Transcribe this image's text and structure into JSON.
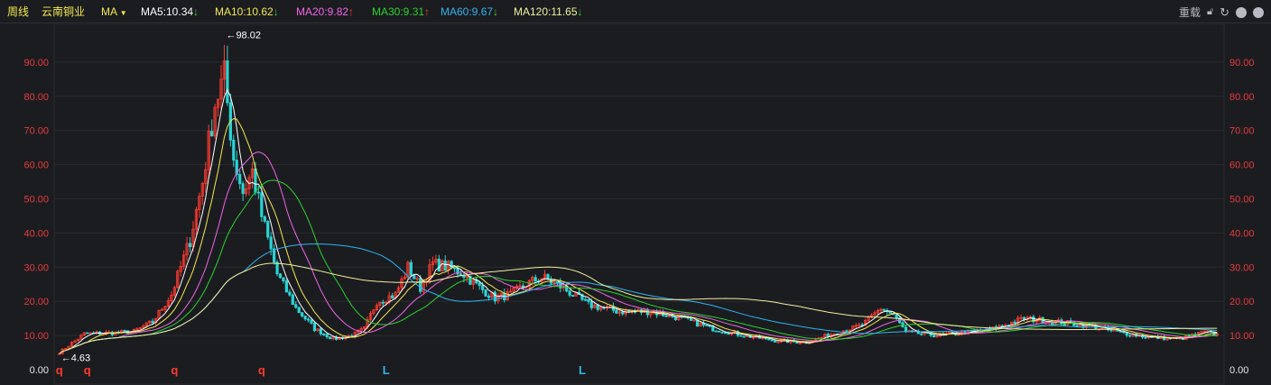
{
  "toolbar": {
    "period": "周线",
    "stock_name": "云南铜业",
    "indicator": "MA",
    "ma": [
      {
        "label": "MA5:10.34",
        "arrow": "↓",
        "color": "#ffffff",
        "arrow_color": "#2bd32b"
      },
      {
        "label": "MA10:10.62",
        "arrow": "↓",
        "color": "#f6e94c",
        "arrow_color": "#2bd32b"
      },
      {
        "label": "MA20:9.82",
        "arrow": "↑",
        "color": "#f065e8",
        "arrow_color": "#ff3b30"
      },
      {
        "label": "MA30:9.31",
        "arrow": "↑",
        "color": "#2bd32b",
        "arrow_color": "#ff3b30"
      },
      {
        "label": "MA60:9.67",
        "arrow": "↓",
        "color": "#2fb5f0",
        "arrow_color": "#2bd32b"
      },
      {
        "label": "MA120:11.65",
        "arrow": "↓",
        "color": "#f2ef9b",
        "arrow_color": "#2bd32b"
      }
    ],
    "reload_label": "重载",
    "icons": [
      "lock-icon",
      "refresh-icon",
      "zoom-in-icon",
      "zoom-out-icon"
    ]
  },
  "chart_data": {
    "type": "candlestick",
    "ylim": [
      0,
      100
    ],
    "y_ticks": [
      "0.00",
      "10.00",
      "20.00",
      "30.00",
      "40.00",
      "50.00",
      "60.00",
      "70.00",
      "80.00",
      "90.00"
    ],
    "y_tick_values": [
      0,
      10,
      20,
      30,
      40,
      50,
      60,
      70,
      80,
      90
    ],
    "max_annotation": "←98.02",
    "min_annotation": "←4.63",
    "max_value": 98.02,
    "min_value": 4.63,
    "price_path": [
      [
        0,
        5.0
      ],
      [
        8,
        10.5
      ],
      [
        18,
        10.8
      ],
      [
        24,
        11.2
      ],
      [
        30,
        14
      ],
      [
        36,
        22
      ],
      [
        42,
        38
      ],
      [
        46,
        55
      ],
      [
        50,
        78
      ],
      [
        53,
        86
      ],
      [
        56,
        62
      ],
      [
        59,
        52
      ],
      [
        62,
        58
      ],
      [
        65,
        45
      ],
      [
        70,
        28
      ],
      [
        76,
        18
      ],
      [
        82,
        12
      ],
      [
        88,
        9
      ],
      [
        94,
        10
      ],
      [
        98,
        12
      ],
      [
        102,
        20
      ],
      [
        108,
        22
      ],
      [
        112,
        30
      ],
      [
        116,
        24
      ],
      [
        120,
        31
      ],
      [
        125,
        30
      ],
      [
        130,
        28
      ],
      [
        135,
        24
      ],
      [
        140,
        21
      ],
      [
        145,
        22
      ],
      [
        150,
        25
      ],
      [
        155,
        27
      ],
      [
        160,
        25
      ],
      [
        165,
        22
      ],
      [
        170,
        19
      ],
      [
        175,
        18
      ],
      [
        180,
        17
      ],
      [
        190,
        17
      ],
      [
        200,
        15
      ],
      [
        210,
        12
      ],
      [
        220,
        10
      ],
      [
        230,
        8.5
      ],
      [
        240,
        8
      ],
      [
        250,
        11
      ],
      [
        258,
        13
      ],
      [
        264,
        18
      ],
      [
        268,
        16
      ],
      [
        272,
        11
      ],
      [
        282,
        10
      ],
      [
        292,
        11
      ],
      [
        300,
        12
      ],
      [
        310,
        15
      ],
      [
        320,
        14
      ],
      [
        330,
        13
      ],
      [
        340,
        11
      ],
      [
        350,
        9.5
      ],
      [
        360,
        9
      ],
      [
        368,
        11
      ],
      [
        372,
        10.3
      ]
    ],
    "markers": [
      {
        "label": "q",
        "index": 0,
        "color": "#ff3b30"
      },
      {
        "label": "q",
        "index": 9,
        "color": "#ff3b30"
      },
      {
        "label": "q",
        "index": 37,
        "color": "#ff3b30"
      },
      {
        "label": "q",
        "index": 65,
        "color": "#ff3b30"
      },
      {
        "label": "L",
        "index": 105,
        "color": "#2fb5f0"
      },
      {
        "label": "L",
        "index": 168,
        "color": "#2fb5f0"
      }
    ],
    "colors": {
      "up": "#ff3b30",
      "down": "#2ad4d4",
      "background": "#1b1c20",
      "grid": "#2a2b31",
      "tick": "#e83a3a"
    }
  }
}
